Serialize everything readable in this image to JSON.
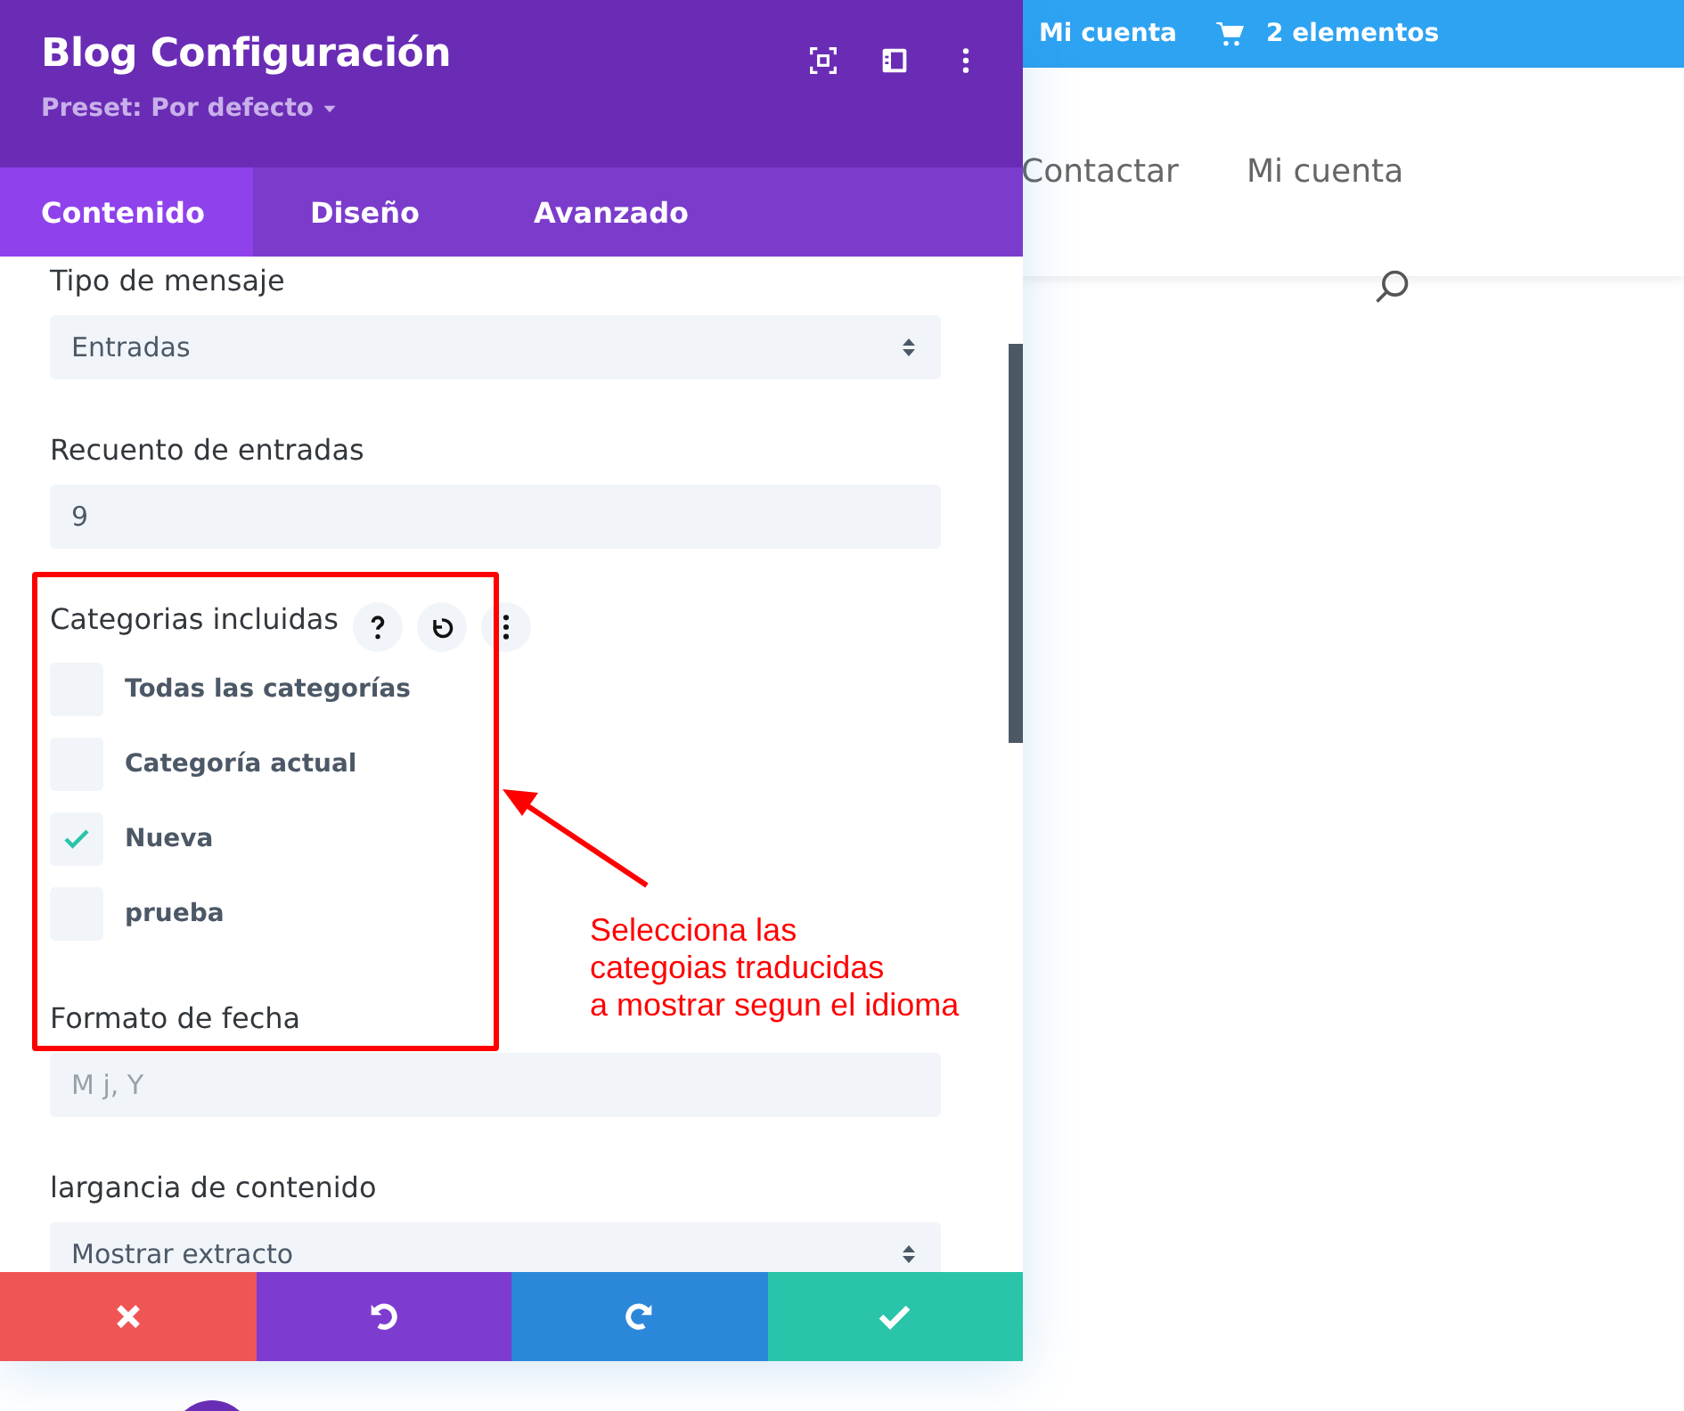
{
  "panel": {
    "title": "Blog Configuración",
    "preset": "Preset: Por defecto",
    "tabs": [
      {
        "label": "Contenido",
        "selected": true
      },
      {
        "label": "Diseño",
        "selected": false
      },
      {
        "label": "Avanzado",
        "selected": false
      }
    ],
    "fields": [
      {
        "kind": "select",
        "label": "Tipo de mensaje",
        "value": "Entradas"
      },
      {
        "kind": "input",
        "label": "Recuento de entradas",
        "value": "9"
      },
      {
        "kind": "checklist",
        "label": "Categorias incluidas",
        "options": [
          {
            "label": "Todas las categorías",
            "checked": false
          },
          {
            "label": "Categoría actual",
            "checked": false
          },
          {
            "label": "Nueva",
            "checked": true
          },
          {
            "label": "prueba",
            "checked": false
          }
        ]
      },
      {
        "kind": "input",
        "label": "Formato de fecha",
        "placeholder": "M j, Y"
      },
      {
        "kind": "select",
        "label": "largancia de contenido",
        "value": "Mostrar extracto"
      }
    ]
  },
  "site": {
    "top_bar": {
      "account": "Mi cuenta",
      "cart": "2 elementos"
    },
    "nav": [
      "Contactar",
      "Mi cuenta"
    ]
  },
  "annotation": {
    "text": "Selecciona las\ncategoias traducidas\na mostrar segun el idioma"
  }
}
